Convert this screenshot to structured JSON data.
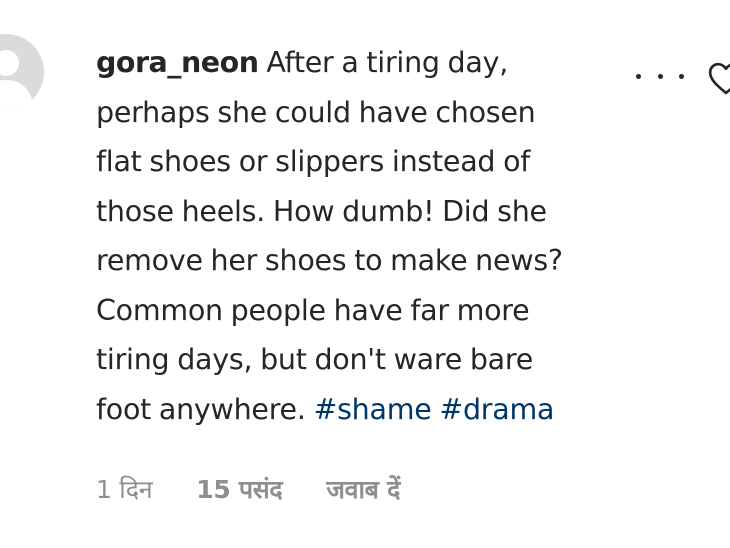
{
  "comment": {
    "username": "gora_neon",
    "lines": [
      "After a tiring day,",
      "perhaps she could have chosen",
      "flat shoes or slippers instead of",
      "those heels. How dumb! Did she",
      "remove her shoes to make news?",
      "Common people have far more",
      "tiring days, but don't ware bare",
      "foot anywhere."
    ],
    "hashtags": [
      "#shame",
      "#drama"
    ]
  },
  "meta": {
    "time": "1 दिन",
    "likes": "15 पसंद",
    "reply": "जवाब दें"
  },
  "icons": {
    "avatar": "default-avatar-icon",
    "more": "more-options-icon",
    "like": "heart-outline-icon"
  },
  "colors": {
    "text": "#262626",
    "hashtag": "#00376b",
    "meta": "#8e8e8e",
    "avatar_bg": "#dbdbdb"
  }
}
